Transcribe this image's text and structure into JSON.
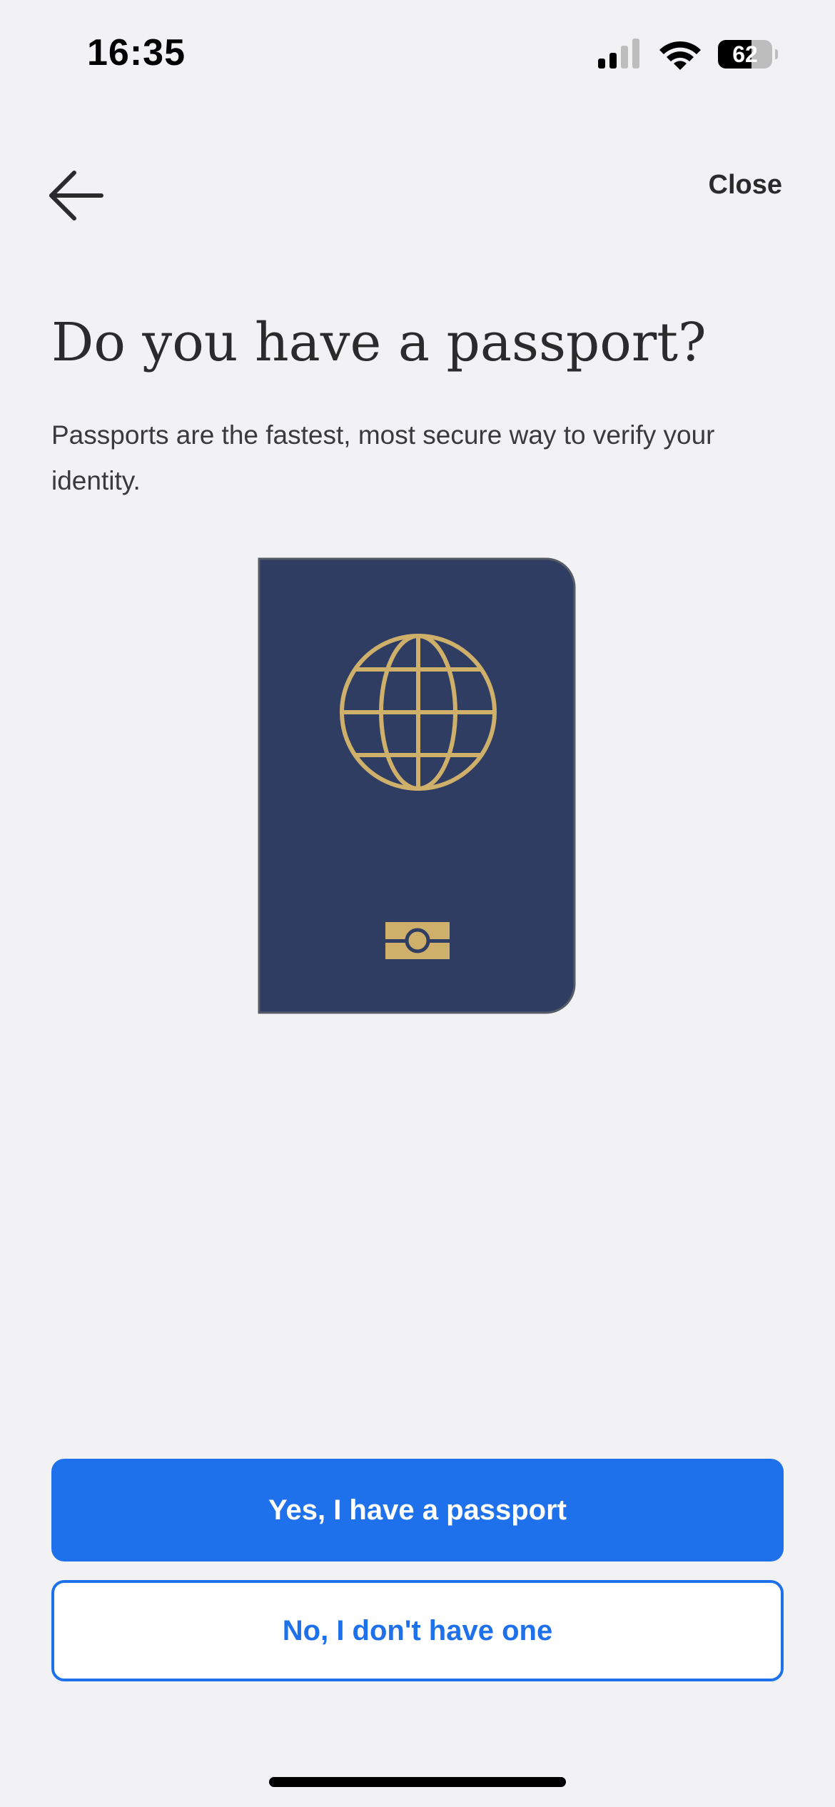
{
  "status_bar": {
    "time": "16:35",
    "battery_percent": "62",
    "battery_level": 0.62,
    "signal_icon": "cellular-signal-icon",
    "wifi_icon": "wifi-icon",
    "battery_icon": "battery-icon"
  },
  "nav": {
    "back_icon": "arrow-left-icon",
    "close_label": "Close"
  },
  "content": {
    "title": "Do you have a passport?",
    "description": "Passports are the fastest, most secure way to verify your identity.",
    "illustration_icon": "passport-illustration"
  },
  "actions": {
    "primary_label": "Yes, I have a passport",
    "secondary_label": "No, I don't have one"
  },
  "colors": {
    "background": "#f2f2f5",
    "accent": "#1e71eb",
    "passport_cover": "#2f3d63",
    "passport_gold": "#cfb06a",
    "text": "#2b2b2b"
  }
}
